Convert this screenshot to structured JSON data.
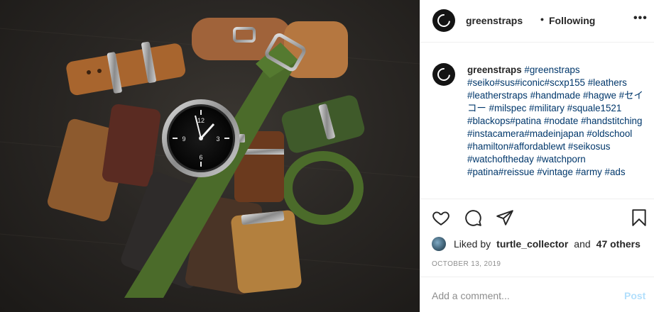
{
  "header": {
    "username": "greenstraps",
    "separator": "•",
    "follow_status": "Following",
    "more_icon": "more-horizontal-icon"
  },
  "caption": {
    "author": "greenstraps",
    "tags_text": "#greenstraps #seiko#sus#iconic#scxp155 #leathers #leatherstraps #handmade #hagwe #セイコー #milspec #military #squale1521 #blackops#patina #nodate #handstitching #instacamera#madeinjapan #oldschool #hamilton#affordablewt #seikosus #watchoftheday #watchporn #patina#reissue #vintage #army #ads"
  },
  "actions": {
    "like_icon": "heart-icon",
    "comment_icon": "comment-icon",
    "share_icon": "paper-plane-icon",
    "save_icon": "bookmark-icon"
  },
  "likes": {
    "prefix": "Liked by",
    "user": "turtle_collector",
    "conjunction": "and",
    "others": "47 others"
  },
  "date": "OCTOBER 13, 2019",
  "comment_box": {
    "placeholder": "Add a comment...",
    "post_label": "Post"
  },
  "colors": {
    "link": "#00376b",
    "post_disabled": "#b2dffc",
    "muted": "#8e8e8e",
    "strap_green": "#4b6b2a",
    "strap_tan": "#a8652e"
  }
}
